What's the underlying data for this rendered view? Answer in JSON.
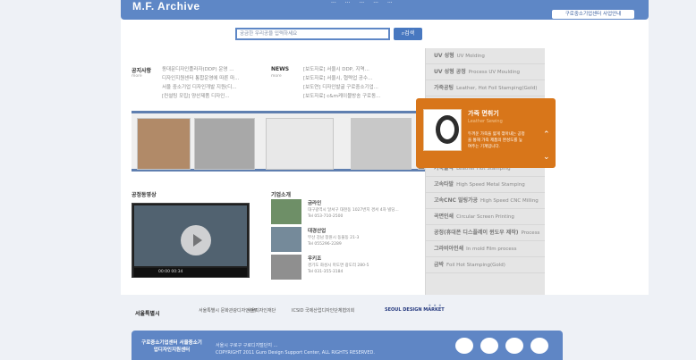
{
  "header": {
    "title": "M.F. Archive",
    "nav": [
      "...",
      "...",
      "...",
      "...",
      "..."
    ],
    "center_link": "구로중소기업센터 사업안내"
  },
  "search": {
    "placeholder": "궁금한 우리공을 입력하세요",
    "button": "검색"
  },
  "news": {
    "notice_title": "공지사항",
    "notice_more": "more",
    "notice_items": [
      "동대문디자인플라자(DDP) 운영 ...",
      "디자인지원센터 통합운영에 따른 마...",
      "서울 중소기업 디자인개발 지원(디...",
      "[컨설팅 모집] 양산제품 디자인..."
    ],
    "news_title": "NEWS",
    "news_more": "more",
    "news_items": [
      "[보도자료] 서울시 DDP, 지역...",
      "[보도자료] 서울시, 협력업 공수...",
      "[보도연] 디자인발굴 구로중소기업...",
      "[보도자료] c&m케이블방송 구로동..."
    ]
  },
  "video": {
    "title": "공정동영상",
    "timestamp": "00:00 00:34"
  },
  "companies": {
    "title": "기업소개",
    "items": [
      {
        "name": "금라인",
        "info": "대구광역시 달서구 대천동 1027번지 경서 4차 빌딩...",
        "tel": "Tel 053-710-2500"
      },
      {
        "name": "대경산업",
        "info": "부산 강남 창원시 동물동 21-3",
        "tel": "Tel 055296-2289"
      },
      {
        "name": "우키조",
        "info": "경기도 화성시 마도면 광도리 280-5",
        "tel": "Tel 031-355-3184"
      }
    ]
  },
  "right_menu": {
    "items": [
      {
        "kr": "UV 성형",
        "en": "UV Molding"
      },
      {
        "kr": "UV 성형 공정",
        "en": "Process  UV Moulding"
      },
      {
        "kr": "가죽공팅",
        "en": "Leather, Hot Foil Stamping(Gold)"
      },
      {
        "kr": "가죽 면취기",
        "en": "Leather Sewing"
      },
      {
        "kr": "가죽불박",
        "en": "Leather Hot Stamping"
      },
      {
        "kr": "고속타발",
        "en": "High Speed Metal Stamping"
      },
      {
        "kr": "고속CNC 밀링가공",
        "en": "High Speed CNC Milling"
      },
      {
        "kr": "곡면인쇄",
        "en": "Circular Screen Printing"
      },
      {
        "kr": "공정(휴대폰 디스플레이 윈도우 제작)",
        "en": "Process"
      },
      {
        "kr": "그라비아인쇄",
        "en": "In mold Film process"
      },
      {
        "kr": "금박",
        "en": "Foil Hot Stamping(Gold)"
      }
    ]
  },
  "featured": {
    "title": "가죽 면취기",
    "subtitle": "Leather Sewing",
    "desc": "두꺼운 가죽을 얇게 깎아내는 공정을 통해 가죽 제품의 완성도를 높여주는 기계입니다."
  },
  "logos": [
    "서울특별시",
    "서울특별시 문화관광디자인본부",
    "서울디자인재단",
    "ICSID 국제산업디자인단체협의회",
    "SEOUL DESIGN MARKET"
  ],
  "footer": {
    "logo": "구로중소기업센터\n서울중소기업디자인지원센터",
    "address": "서울시 구로구 구로디지털단지 ...",
    "copyright": "COPYRIGHT 2011 Guro Design Support Center, ALL RIGHTS RESERVED."
  }
}
